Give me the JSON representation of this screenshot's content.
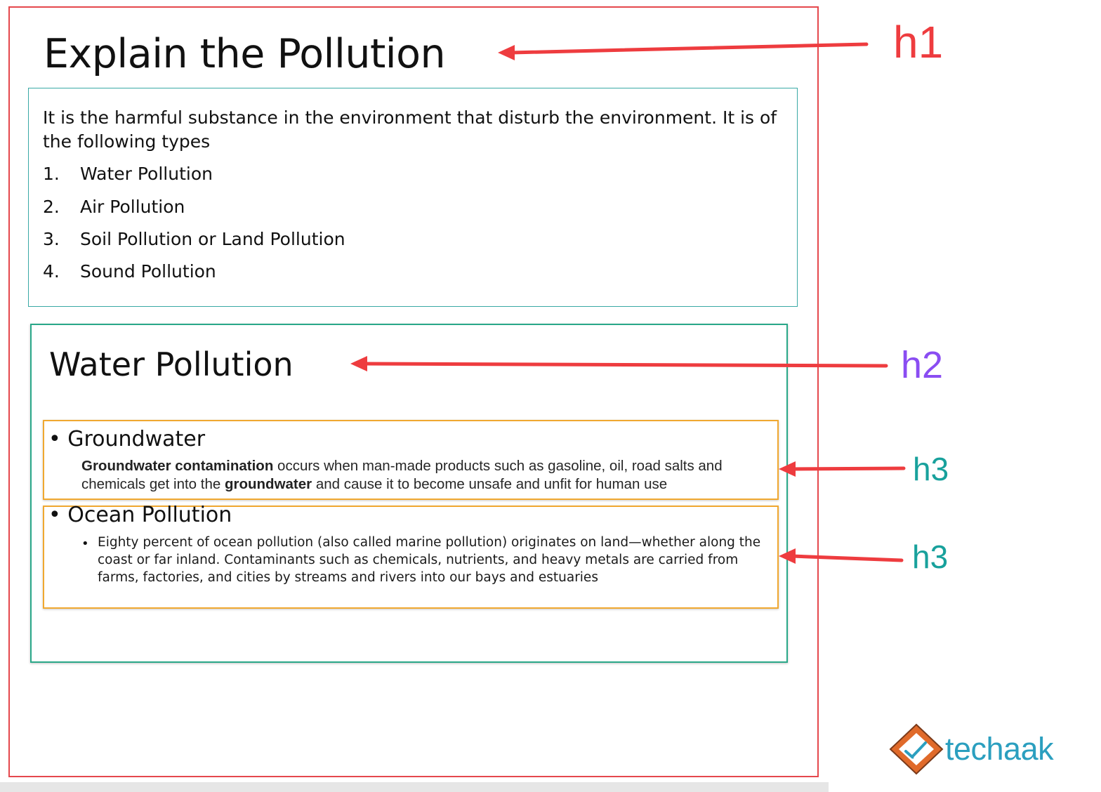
{
  "heading_h1": "Explain the Pollution",
  "intro": {
    "paragraph": "It is the harmful substance in the environment that disturb the environment. It is of the following types",
    "items": [
      {
        "num": "1.",
        "label": "Water Pollution"
      },
      {
        "num": "2.",
        "label": "Air Pollution"
      },
      {
        "num": "3.",
        "label": "Soil Pollution or Land Pollution"
      },
      {
        "num": "4.",
        "label": "Sound Pollution"
      }
    ]
  },
  "heading_h2": "Water Pollution",
  "groundwater": {
    "bullet": "•",
    "heading": "Groundwater",
    "bold_1": "Groundwater contamination",
    "text_1": " occurs when man-made products such as gasoline, oil, road salts and chemicals get into the ",
    "bold_2": "groundwater",
    "text_2": " and cause it to become unsafe and unfit for human use"
  },
  "ocean": {
    "bullet": "•",
    "heading": "Ocean Pollution",
    "sub_bullet": "•",
    "text": "Eighty percent of ocean pollution (also called marine pollution) originates on land—whether along the coast or far inland. Contaminants such as chemicals, nutrients, and heavy metals are carried from farms, factories, and cities by streams and rivers into our bays and estuaries"
  },
  "labels": {
    "h1": "h1",
    "h2": "h2",
    "h3_first": "h3",
    "h3_second": "h3"
  },
  "logo": {
    "text": "techaak"
  },
  "colors": {
    "h1_frame": "#e5484d",
    "h2_frame": "#2aa889",
    "h3_frame": "#f0a830",
    "arrow": "#ee3c3f",
    "label_h1": "#ee3c3f",
    "label_h2": "#8a4df2",
    "label_h3": "#18a19c",
    "logo_text": "#2b9fbf"
  }
}
